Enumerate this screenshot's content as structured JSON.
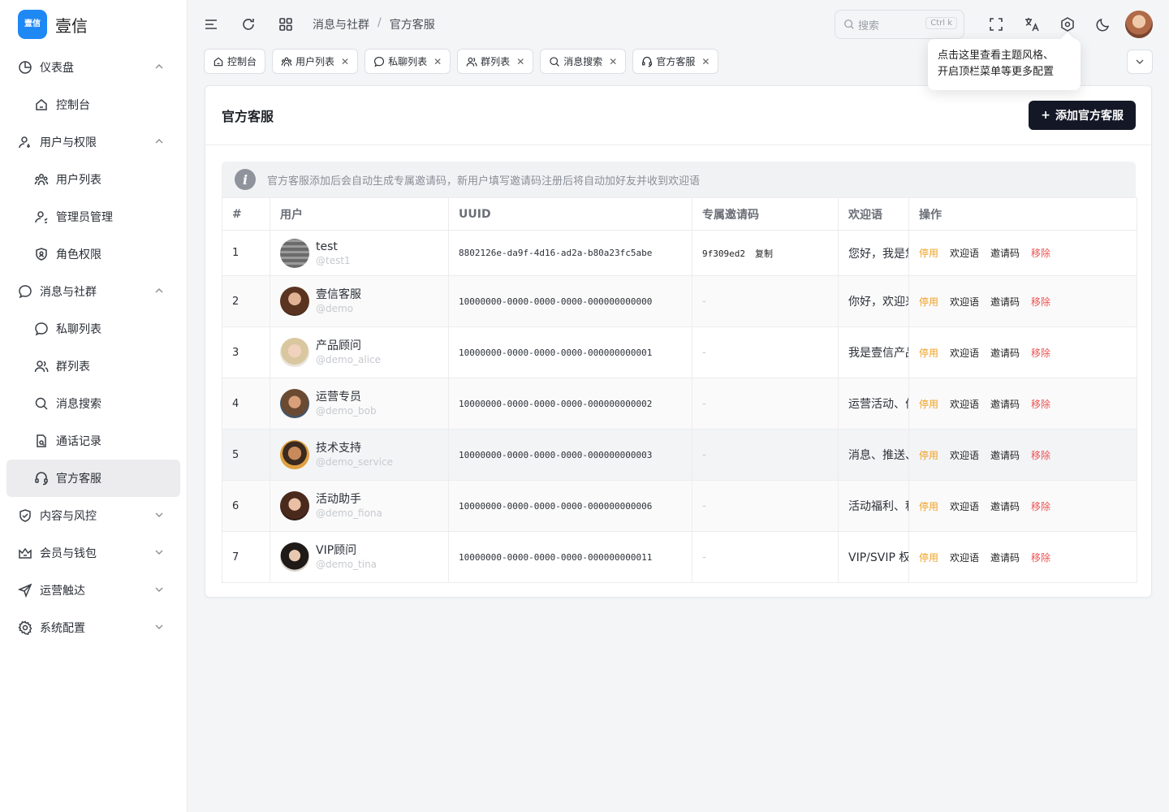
{
  "app": {
    "name": "壹信",
    "logo_text": "壹信"
  },
  "sidebar": {
    "items": [
      {
        "label": "仪表盘",
        "icon": "pie-chart-icon",
        "level": 0,
        "chevron": "up"
      },
      {
        "label": "控制台",
        "icon": "home-icon",
        "level": 1
      },
      {
        "label": "用户与权限",
        "icon": "user-key-icon",
        "level": 0,
        "chevron": "up"
      },
      {
        "label": "用户列表",
        "icon": "users-icon",
        "level": 1
      },
      {
        "label": "管理员管理",
        "icon": "admin-icon",
        "level": 1
      },
      {
        "label": "角色权限",
        "icon": "shield-icon",
        "level": 1
      },
      {
        "label": "消息与社群",
        "icon": "chat-icon",
        "level": 0,
        "chevron": "up"
      },
      {
        "label": "私聊列表",
        "icon": "chat-bubble-icon",
        "level": 1
      },
      {
        "label": "群列表",
        "icon": "group-icon",
        "level": 1
      },
      {
        "label": "消息搜索",
        "icon": "search-icon",
        "level": 1
      },
      {
        "label": "通话记录",
        "icon": "call-record-icon",
        "level": 1
      },
      {
        "label": "官方客服",
        "icon": "headset-icon",
        "level": 1,
        "active": true
      },
      {
        "label": "内容与风控",
        "icon": "shield-check-icon",
        "level": 0,
        "chevron": "down"
      },
      {
        "label": "会员与钱包",
        "icon": "crown-icon",
        "level": 0,
        "chevron": "down"
      },
      {
        "label": "运营触达",
        "icon": "send-icon",
        "level": 0,
        "chevron": "down"
      },
      {
        "label": "系统配置",
        "icon": "gear-icon",
        "level": 0,
        "chevron": "down"
      }
    ]
  },
  "header": {
    "breadcrumb": [
      "消息与社群",
      "官方客服"
    ],
    "breadcrumb_sep": "/",
    "search_placeholder": "搜索",
    "search_shortcut": "Ctrl k"
  },
  "tabs": [
    {
      "label": "控制台",
      "icon": "home-icon",
      "closable": false
    },
    {
      "label": "用户列表",
      "icon": "users-icon",
      "closable": true
    },
    {
      "label": "私聊列表",
      "icon": "chat-bubble-icon",
      "closable": true
    },
    {
      "label": "群列表",
      "icon": "group-icon",
      "closable": true
    },
    {
      "label": "消息搜索",
      "icon": "search-icon",
      "closable": true
    },
    {
      "label": "官方客服",
      "icon": "headset-icon",
      "closable": true,
      "active": true
    }
  ],
  "tooltip": {
    "line1": "点击这里查看主题风格、",
    "line2": "开启顶栏菜单等更多配置"
  },
  "page": {
    "title": "官方客服",
    "add_button": "添加官方客服",
    "notice": "官方客服添加后会自动生成专属邀请码，新用户填写邀请码注册后将自动加好友并收到欢迎语"
  },
  "table": {
    "columns": [
      "#",
      "用户",
      "UUID",
      "专属邀请码",
      "欢迎语",
      "操作"
    ],
    "rows": [
      {
        "idx": "1",
        "name": "test",
        "handle": "@test1",
        "uuid": "8802126e-da9f-4d16-ad2a-b80a23fc5abe",
        "invite": "9f309ed2",
        "copy": "复制",
        "welcome": "您好，我是您的专属客服"
      },
      {
        "idx": "2",
        "name": "壹信客服",
        "handle": "@demo",
        "uuid": "10000000-0000-0000-0000-000000000000",
        "invite": "-",
        "welcome": "你好，欢迎来到壹信"
      },
      {
        "idx": "3",
        "name": "产品顾问",
        "handle": "@demo_alice",
        "uuid": "10000000-0000-0000-0000-000000000001",
        "invite": "-",
        "welcome": "我是壹信产品顾问"
      },
      {
        "idx": "4",
        "name": "运营专员",
        "handle": "@demo_bob",
        "uuid": "10000000-0000-0000-0000-000000000002",
        "invite": "-",
        "welcome": "运营活动、优惠咨询"
      },
      {
        "idx": "5",
        "name": "技术支持",
        "handle": "@demo_service",
        "uuid": "10000000-0000-0000-0000-000000000003",
        "invite": "-",
        "welcome": "消息、推送、通话问题"
      },
      {
        "idx": "6",
        "name": "活动助手",
        "handle": "@demo_fiona",
        "uuid": "10000000-0000-0000-0000-000000000006",
        "invite": "-",
        "welcome": "活动福利、积分咨询"
      },
      {
        "idx": "7",
        "name": "VIP顾问",
        "handle": "@demo_tina",
        "uuid": "10000000-0000-0000-0000-000000000011",
        "invite": "-",
        "welcome": "VIP/SVIP 权益咨询"
      }
    ],
    "actions": {
      "disable": "停用",
      "welcome": "欢迎语",
      "invite": "邀请码",
      "remove": "移除"
    }
  },
  "colors": {
    "brand": "#1e88f5",
    "primary_button": "#141826",
    "warn": "#f0a020",
    "danger": "#f05050"
  }
}
